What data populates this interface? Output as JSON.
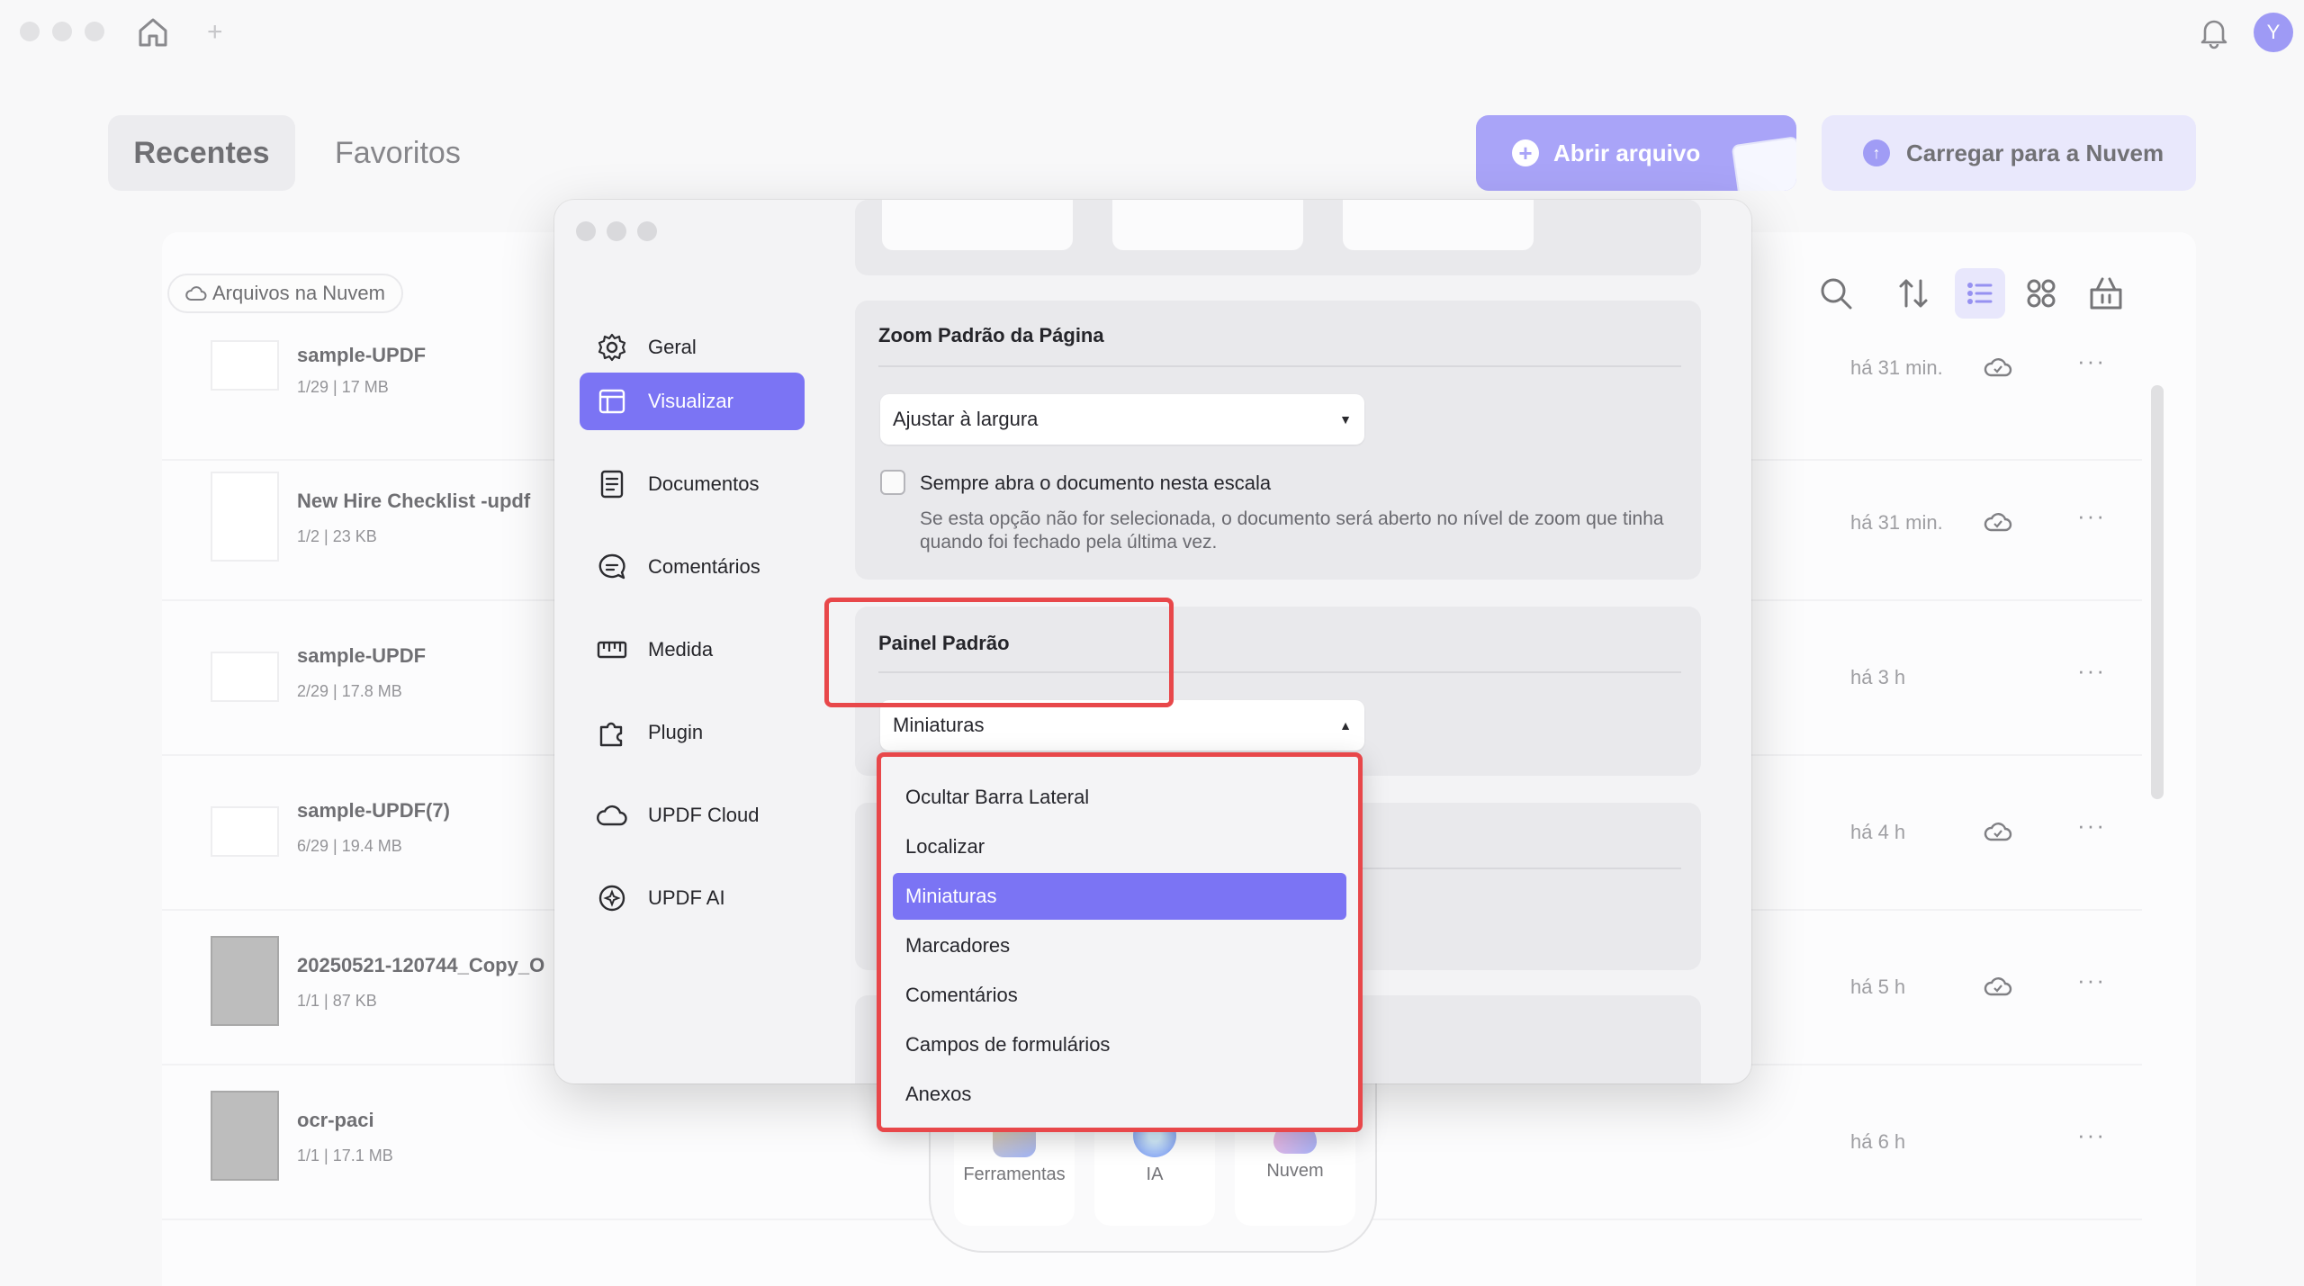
{
  "header": {
    "tabs": [
      {
        "label": "Recentes",
        "active": true
      },
      {
        "label": "Favoritos",
        "active": false
      }
    ],
    "open_file": "Abrir arquivo",
    "upload_cloud": "Carregar para a Nuvem",
    "avatar_initial": "Y"
  },
  "filters": {
    "cloud_files": "Arquivos na Nuvem"
  },
  "files": [
    {
      "name": "sample-UPDF",
      "meta": "1/29 | 17 MB",
      "time": "há 31 min.",
      "cloud": true
    },
    {
      "name": "New Hire Checklist -updf",
      "meta": "1/2 | 23 KB",
      "time": "há 31 min.",
      "cloud": true
    },
    {
      "name": "sample-UPDF",
      "meta": "2/29 | 17.8 MB",
      "time": "há 3 h",
      "cloud": false
    },
    {
      "name": "sample-UPDF(7)",
      "meta": "6/29 | 19.4 MB",
      "time": "há 4 h",
      "cloud": true
    },
    {
      "name": "20250521-120744_Copy_O",
      "meta": "1/1 | 87 KB",
      "time": "há 5 h",
      "cloud": true
    },
    {
      "name": "ocr-paci",
      "meta": "1/1 | 17.1 MB",
      "time": "há 6 h",
      "cloud": false
    }
  ],
  "dock": {
    "items": [
      {
        "label": "Ferramentas"
      },
      {
        "label": "IA"
      },
      {
        "label": "Nuvem"
      }
    ]
  },
  "settings": {
    "nav": [
      {
        "label": "Geral",
        "icon": "gear-icon"
      },
      {
        "label": "Visualizar",
        "icon": "layout-icon",
        "active": true
      },
      {
        "label": "Documentos",
        "icon": "document-icon"
      },
      {
        "label": "Comentários",
        "icon": "comment-icon"
      },
      {
        "label": "Medida",
        "icon": "ruler-icon"
      },
      {
        "label": "Plugin",
        "icon": "puzzle-icon"
      },
      {
        "label": "UPDF Cloud",
        "icon": "cloud-icon"
      },
      {
        "label": "UPDF AI",
        "icon": "ai-icon"
      }
    ],
    "zoom": {
      "title": "Zoom Padrão da Página",
      "selected": "Ajustar à largura",
      "checkbox_label": "Sempre abra o documento nesta escala",
      "checkbox_checked": false,
      "help": "Se esta opção não for selecionada, o documento será aberto no nível de zoom que tinha quando foi fechado pela última vez."
    },
    "panel": {
      "title": "Painel Padrão",
      "selected": "Miniaturas",
      "options": [
        "Ocultar Barra Lateral",
        "Localizar",
        "Miniaturas",
        "Marcadores",
        "Comentários",
        "Campos de formulários",
        "Anexos"
      ]
    }
  },
  "colors": {
    "accent": "#7b74f4",
    "highlight": "#e8474a"
  }
}
